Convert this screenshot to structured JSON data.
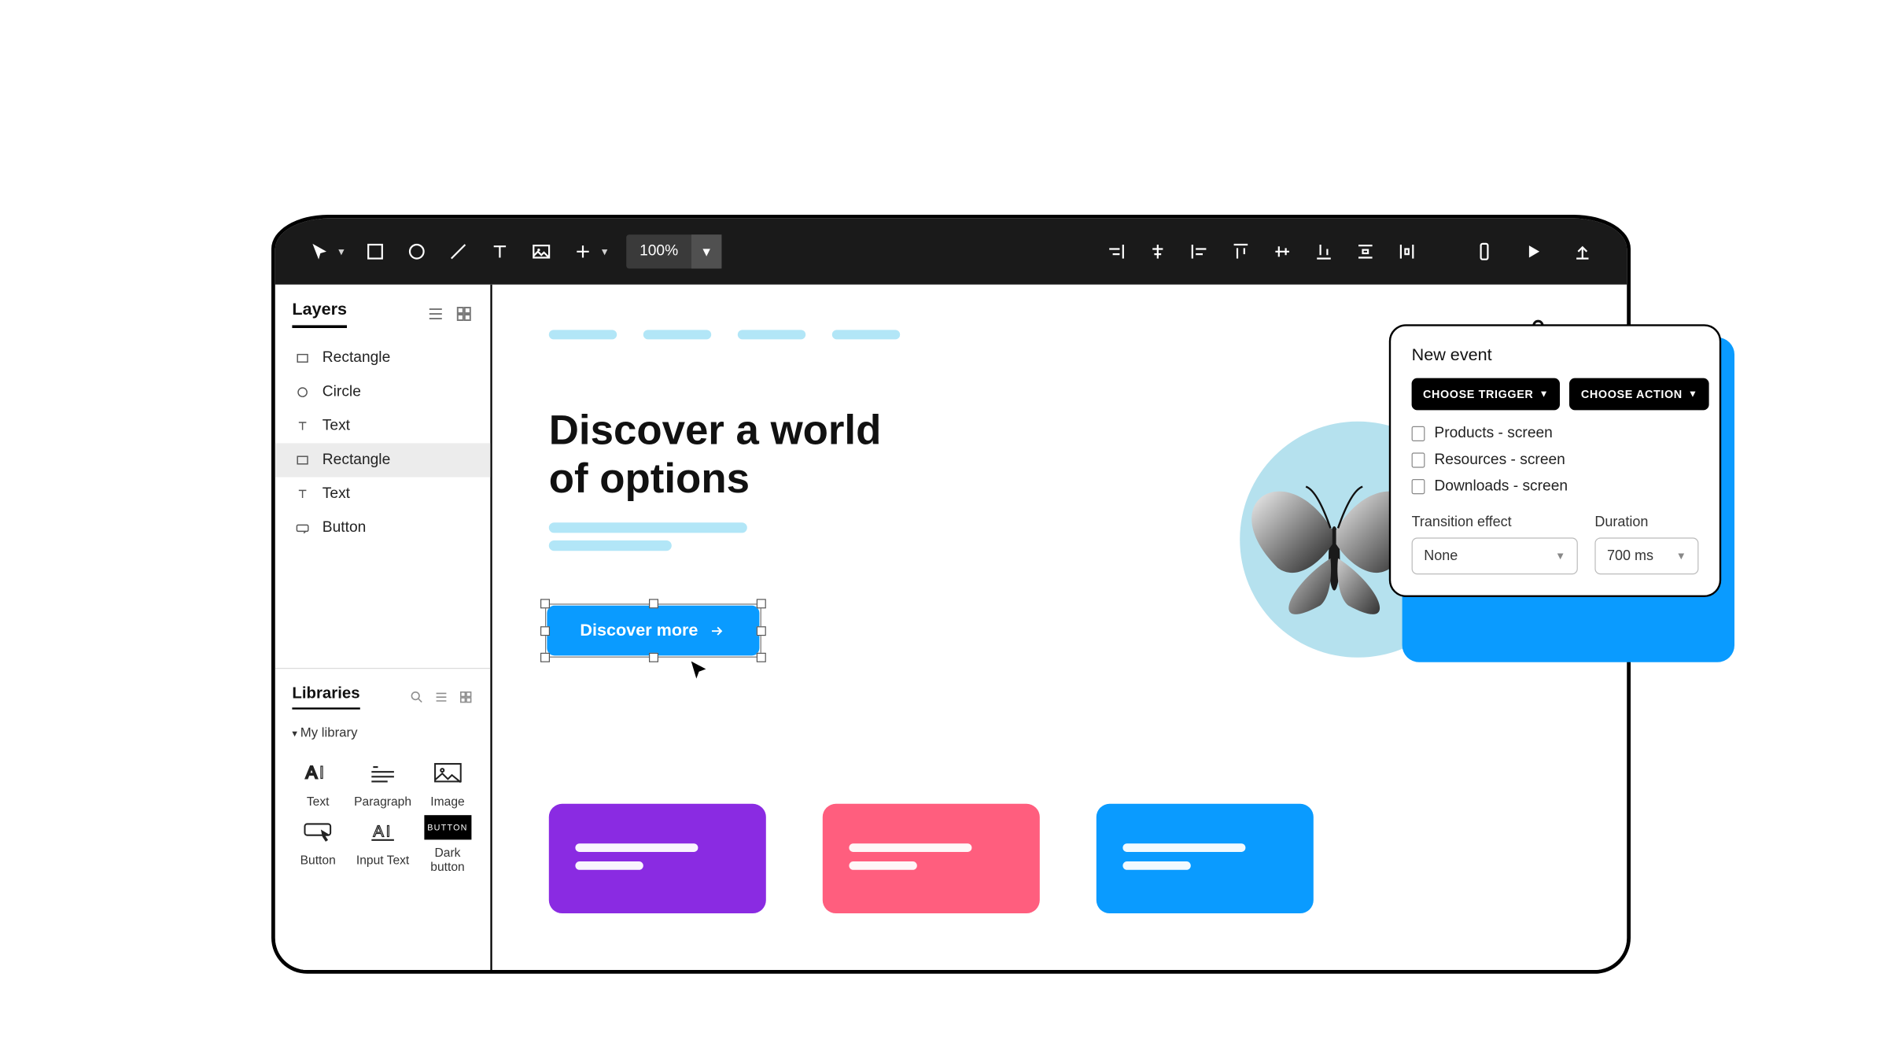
{
  "toolbar": {
    "zoom": "100%"
  },
  "left_panel": {
    "layers_title": "Layers",
    "layers": [
      "Rectangle",
      "Circle",
      "Text",
      "Rectangle",
      "Text",
      "Button"
    ],
    "libraries_title": "Libraries",
    "my_library": "My library",
    "items": [
      "Text",
      "Paragraph",
      "Image",
      "Button",
      "Input Text",
      "Dark button"
    ],
    "dark_button_label": "BUTTON"
  },
  "hero": {
    "title_line1": "Discover a world",
    "title_line2": "of options",
    "cta_label": "Discover more"
  },
  "event_panel": {
    "title": "New event",
    "trigger_btn": "CHOOSE TRIGGER",
    "action_btn": "CHOOSE ACTION",
    "screens": [
      "Products - screen",
      "Resources - screen",
      "Downloads  - screen"
    ],
    "transition_label": "Transition effect",
    "transition_value": "None",
    "duration_label": "Duration",
    "duration_value": "700 ms"
  }
}
